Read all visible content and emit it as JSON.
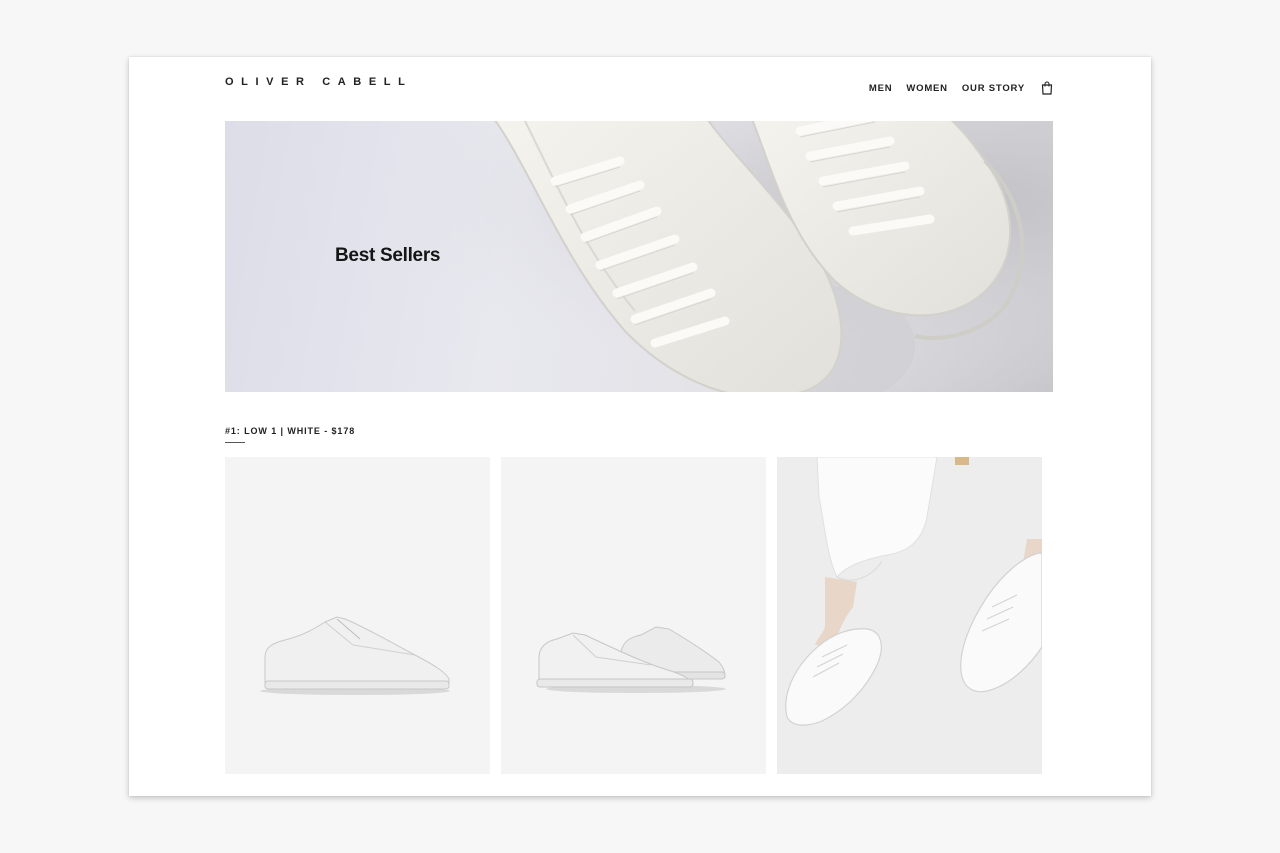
{
  "brand": {
    "logo_text": "OLIVER CABELL"
  },
  "nav": {
    "items": [
      {
        "label": "MEN"
      },
      {
        "label": "WOMEN"
      },
      {
        "label": "OUR STORY"
      }
    ],
    "cart_icon": "shopping-bag-icon"
  },
  "hero": {
    "title": "Best Sellers"
  },
  "product": {
    "heading": "#1: LOW 1 | WHITE - $178"
  },
  "gallery": {
    "tiles": [
      {
        "icon": "sneaker-side-view-image"
      },
      {
        "icon": "sneaker-pair-image"
      },
      {
        "icon": "sneakers-on-feet-image"
      }
    ]
  },
  "colors": {
    "text": "#222222",
    "page_bg": "#f7f7f7",
    "card_bg": "#ffffff",
    "tile_bg": "#f4f4f4"
  }
}
